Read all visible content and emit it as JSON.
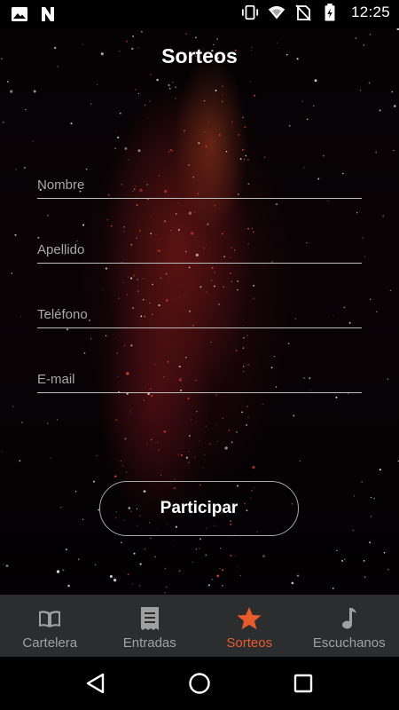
{
  "status_bar": {
    "time": "12:25",
    "left_icons": [
      "image-icon",
      "n-app-icon"
    ],
    "right_icons": [
      "vibrate-icon",
      "wifi-icon",
      "no-sim-icon",
      "battery-icon"
    ]
  },
  "header": {
    "title": "Sorteos"
  },
  "form": {
    "fields": [
      {
        "name": "nombre",
        "placeholder": "Nombre",
        "value": ""
      },
      {
        "name": "apellido",
        "placeholder": "Apellido",
        "value": ""
      },
      {
        "name": "telefono",
        "placeholder": "Teléfono",
        "value": ""
      },
      {
        "name": "email",
        "placeholder": "E-mail",
        "value": ""
      }
    ],
    "submit_label": "Participar"
  },
  "bottom_nav": {
    "items": [
      {
        "label": "Cartelera",
        "icon": "book-icon",
        "active": false
      },
      {
        "label": "Entradas",
        "icon": "ticket-icon",
        "active": false
      },
      {
        "label": "Sorteos",
        "icon": "star-icon",
        "active": true
      },
      {
        "label": "Escuchanos",
        "icon": "music-note-icon",
        "active": false
      }
    ]
  },
  "colors": {
    "accent": "#e85c2c",
    "nav_background": "#2b2d2f",
    "inactive": "#a0a0a0",
    "text": "#ffffff"
  },
  "system_nav": [
    "back-icon",
    "home-icon",
    "recents-icon"
  ]
}
